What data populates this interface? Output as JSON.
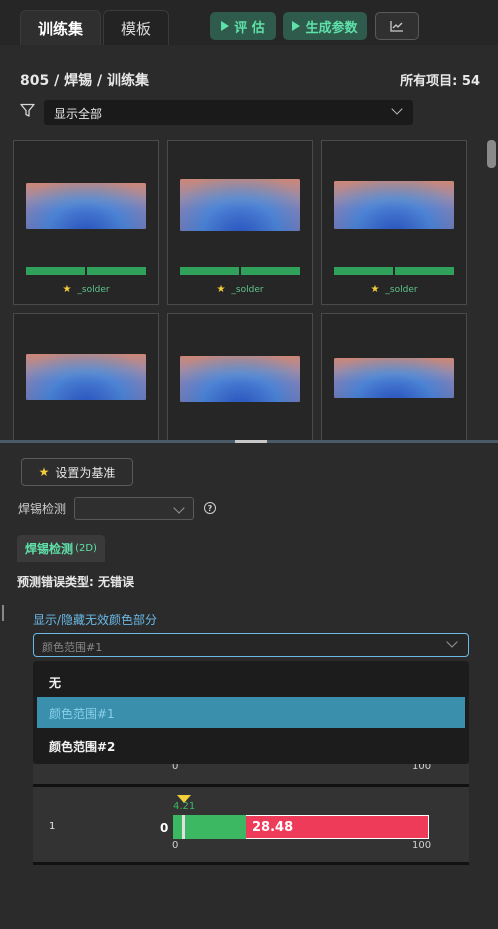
{
  "tabs": [
    {
      "label": "训练集",
      "active": true
    },
    {
      "label": "模板",
      "active": false
    }
  ],
  "toolbar": {
    "evaluate_label": "评 估",
    "generate_label": "生成参数",
    "chart_icon": "chart-icon"
  },
  "breadcrumb": "805 / 焊锡 / 训练集",
  "total_items": "所有项目:  54",
  "filter": {
    "icon": "filter-icon",
    "selected": "显示全部"
  },
  "cards": [
    {
      "label": "_solder",
      "starred": true
    },
    {
      "label": "_solder",
      "starred": true
    },
    {
      "label": "_solder",
      "starred": true
    },
    {
      "label": "",
      "starred": false
    },
    {
      "label": "",
      "starred": false
    },
    {
      "label": "",
      "starred": false
    }
  ],
  "panel": {
    "set_baseline_label": "设置为基准",
    "solder_detect_label": "焊锡检测",
    "solder_detect_value": "",
    "subtab_label": "焊锡检测",
    "subtab_suffix": "(2D)",
    "predict_error": "预测错误类型: 无错误",
    "toggle_link": "显示/隐藏无效颜色部分",
    "color_select_value": "颜色范围#1",
    "dropdown_options": [
      "无",
      "颜色范围#1",
      "颜色范围#2"
    ],
    "dropdown_selected": 1
  },
  "chart_data": {
    "type": "bar",
    "rows": [
      {
        "index": "",
        "axis_min": "0",
        "axis_max": "100"
      },
      {
        "index": "1",
        "left_value": "0",
        "marker_value": "4.21",
        "green_to": 28.48,
        "red_value": "28.48",
        "axis_min": "0",
        "axis_max": "100"
      }
    ],
    "xlim": [
      0,
      100
    ]
  },
  "colors": {
    "accent_green": "#5fe0a8",
    "green_bar": "#3cb862",
    "red_bar": "#ef3b5a",
    "highlight": "#3a8fad",
    "link": "#6ab9e6",
    "star": "#f3cd3a"
  }
}
